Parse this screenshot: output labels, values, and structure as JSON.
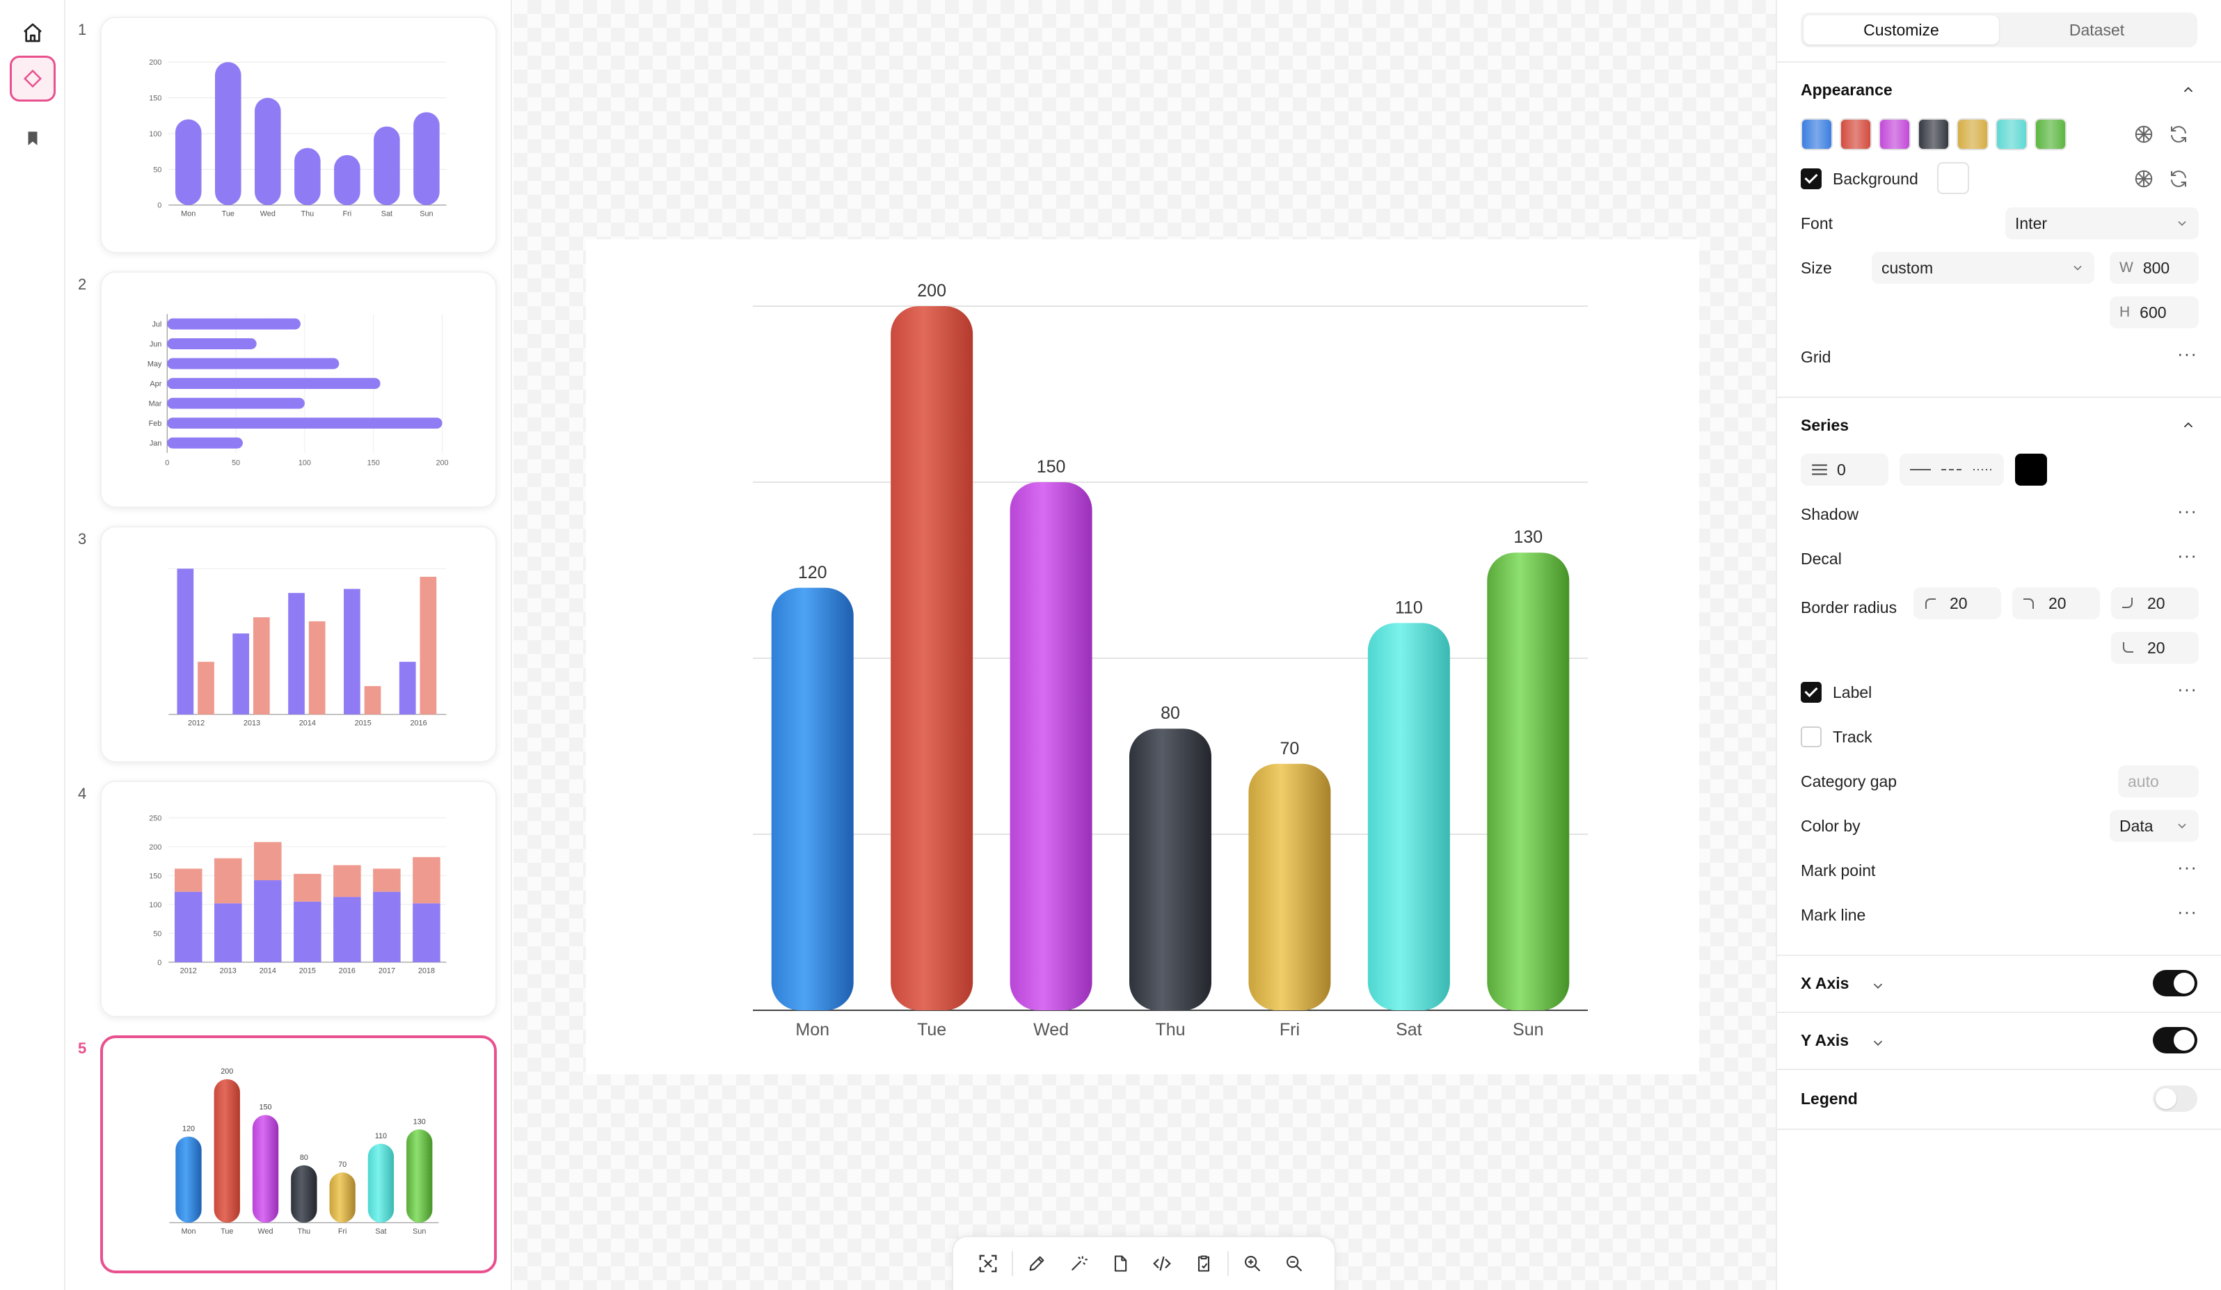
{
  "thumbnails": {
    "numbers": [
      "1",
      "2",
      "3",
      "4",
      "5"
    ],
    "t1": {
      "categories": [
        "Mon",
        "Tue",
        "Wed",
        "Thu",
        "Fri",
        "Sat",
        "Sun"
      ],
      "values": [
        120,
        200,
        150,
        80,
        70,
        110,
        130
      ],
      "yticks": [
        "0",
        "50",
        "100",
        "150",
        "200"
      ]
    },
    "t2": {
      "categories": [
        "Jan",
        "Feb",
        "Mar",
        "Apr",
        "May",
        "Jun",
        "Jul"
      ],
      "values": [
        55,
        200,
        100,
        155,
        125,
        65,
        97
      ],
      "xticks": [
        "0",
        "50",
        "100",
        "150",
        "200"
      ]
    },
    "t3": {
      "categories": [
        "2012",
        "2013",
        "2014",
        "2015",
        "2016"
      ],
      "series_a": [
        180,
        100,
        150,
        155,
        65
      ],
      "series_b": [
        65,
        120,
        115,
        35,
        170
      ]
    },
    "t4": {
      "categories": [
        "2012",
        "2013",
        "2014",
        "2015",
        "2016",
        "2017",
        "2018"
      ],
      "bottom": [
        122,
        102,
        142,
        105,
        113,
        122,
        102
      ],
      "top": [
        40,
        78,
        66,
        48,
        55,
        40,
        80
      ],
      "yticks": [
        "0",
        "50",
        "100",
        "150",
        "200",
        "250"
      ]
    },
    "t5": {
      "categories": [
        "Mon",
        "Tue",
        "Wed",
        "Thu",
        "Fri",
        "Sat",
        "Sun"
      ],
      "values": [
        120,
        200,
        150,
        80,
        70,
        110,
        130
      ]
    }
  },
  "chart_data": {
    "type": "bar",
    "categories": [
      "Mon",
      "Tue",
      "Wed",
      "Thu",
      "Fri",
      "Sat",
      "Sun"
    ],
    "values": [
      120,
      200,
      150,
      80,
      70,
      110,
      130
    ],
    "data_labels": [
      "120",
      "200",
      "150",
      "80",
      "70",
      "110",
      "130"
    ],
    "ylim": [
      0,
      200
    ],
    "grid": true,
    "colors": [
      [
        "#2f7fd6",
        "#4da3f5",
        "#1e5fb0"
      ],
      [
        "#c94a3c",
        "#e26a5a",
        "#b33a2c"
      ],
      [
        "#b845d6",
        "#d86cf2",
        "#9a2fb8"
      ],
      [
        "#2e323a",
        "#575c66",
        "#23262c"
      ],
      [
        "#c9a23a",
        "#f0cd68",
        "#a8822a"
      ],
      [
        "#4fd6d0",
        "#7df2ec",
        "#3ab8b2"
      ],
      [
        "#5aaa3a",
        "#8ee070",
        "#469228"
      ]
    ]
  },
  "toolbar": {
    "icons": [
      "select-icon",
      "pen-icon",
      "magic-wand-icon",
      "file-icon",
      "code-icon",
      "clipboard-icon",
      "zoom-in-icon",
      "zoom-out-icon"
    ]
  },
  "panel": {
    "tabs": [
      "Customize",
      "Dataset"
    ],
    "appearance": {
      "title": "Appearance",
      "swatches": [
        "#3b7ee0",
        "#d44b3e",
        "#c34ad9",
        "#353942",
        "#d6ae45",
        "#5fd8d3",
        "#5bb640"
      ],
      "background_label": "Background",
      "background_checked": true,
      "font_label": "Font",
      "font_value": "Inter",
      "size_label": "Size",
      "size_value": "custom",
      "width_prefix": "W",
      "width_value": "800",
      "height_prefix": "H",
      "height_value": "600",
      "grid_label": "Grid"
    },
    "series": {
      "title": "Series",
      "line_width_value": "0",
      "shadow_label": "Shadow",
      "decal_label": "Decal",
      "border_radius_label": "Border radius",
      "radius_values": [
        "20",
        "20",
        "20",
        "20"
      ],
      "label_label": "Label",
      "label_checked": true,
      "track_label": "Track",
      "track_checked": false,
      "category_gap_label": "Category gap",
      "category_gap_placeholder": "auto",
      "color_by_label": "Color by",
      "color_by_value": "Data",
      "mark_point_label": "Mark point",
      "mark_line_label": "Mark line"
    },
    "x_axis": {
      "title": "X Axis",
      "enabled": true
    },
    "y_axis": {
      "title": "Y Axis",
      "enabled": true
    },
    "legend": {
      "title": "Legend",
      "enabled": false
    }
  }
}
